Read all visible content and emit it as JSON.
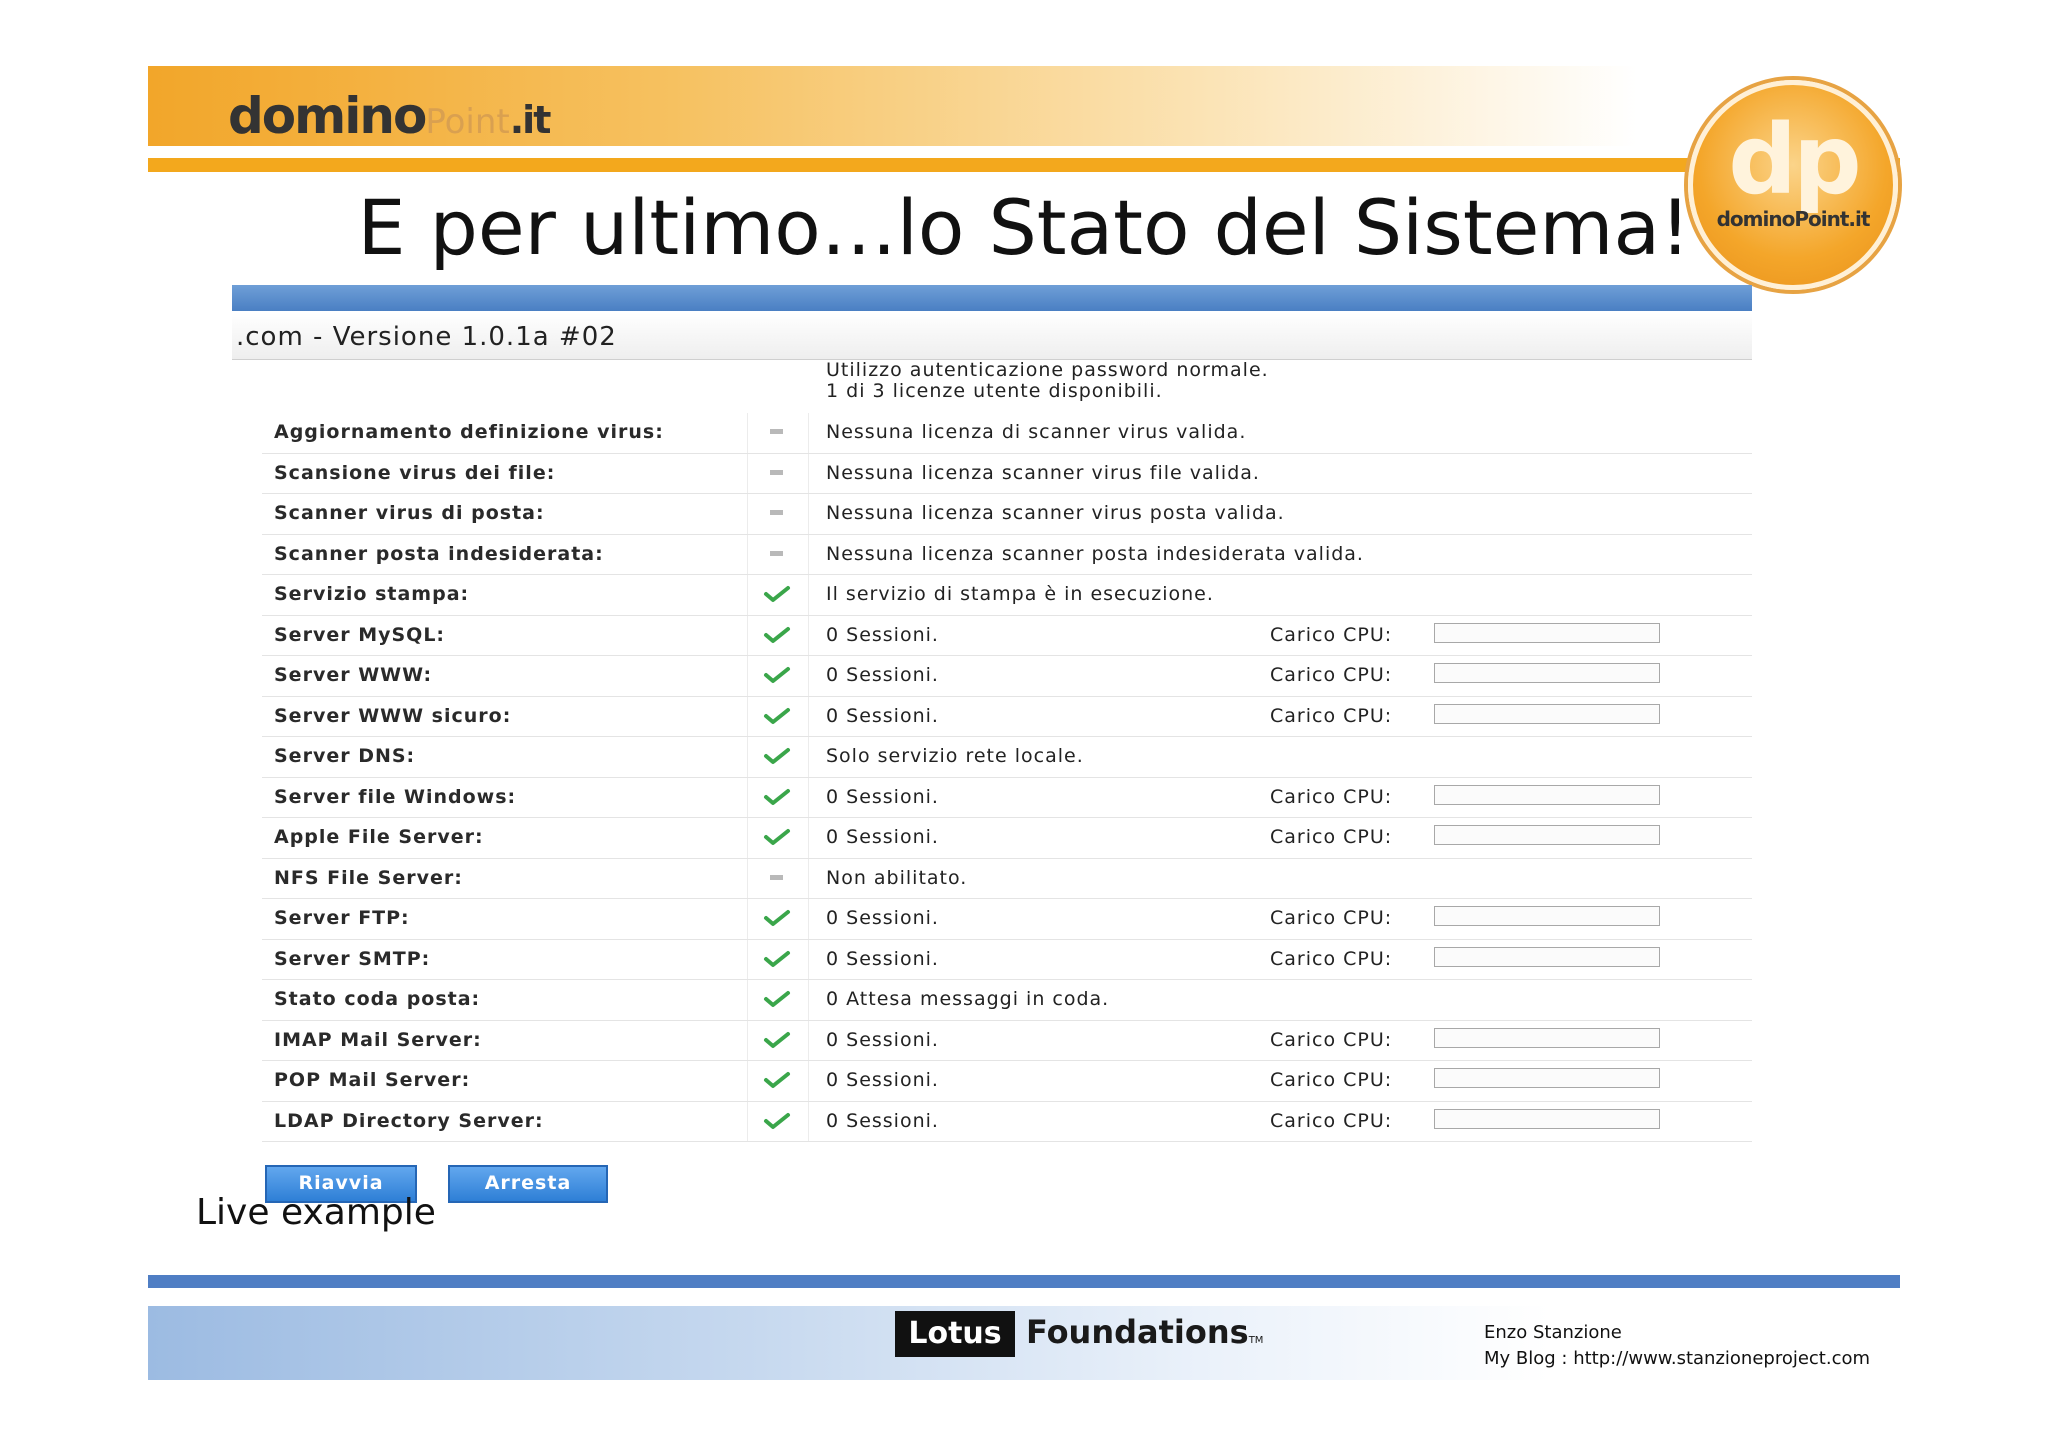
{
  "header": {
    "brand_main": "domino",
    "brand_sub": "Point",
    "brand_suffix": ".it",
    "circle_logo_text": "dp",
    "circle_logo_sub": "dominoPoint.it"
  },
  "slide_title": "E per ultimo…lo Stato del Sistema!",
  "screenshot": {
    "title": ".com - Versione 1.0.1a #02",
    "license_lines": [
      "Utilizzo autenticazione password normale.",
      "1 di 3 licenze utente disponibili."
    ],
    "rows": [
      {
        "name": "Aggiornamento definizione virus:",
        "status": "dash",
        "desc": "Nessuna licenza di scanner virus valida.",
        "cpu": ""
      },
      {
        "name": "Scansione virus dei file:",
        "status": "dash",
        "desc": "Nessuna licenza scanner virus file valida.",
        "cpu": ""
      },
      {
        "name": "Scanner virus di posta:",
        "status": "dash",
        "desc": "Nessuna licenza scanner virus posta valida.",
        "cpu": ""
      },
      {
        "name": "Scanner posta indesiderata:",
        "status": "dash",
        "desc": "Nessuna licenza scanner posta indesiderata valida.",
        "cpu": ""
      },
      {
        "name": "Servizio stampa:",
        "status": "check",
        "desc": "Il servizio di stampa è in esecuzione.",
        "cpu": ""
      },
      {
        "name": "Server MySQL:",
        "status": "check",
        "desc": "0 Sessioni.",
        "cpu": "Carico CPU:"
      },
      {
        "name": "Server WWW:",
        "status": "check",
        "desc": "0 Sessioni.",
        "cpu": "Carico CPU:"
      },
      {
        "name": "Server WWW sicuro:",
        "status": "check",
        "desc": "0 Sessioni.",
        "cpu": "Carico CPU:"
      },
      {
        "name": "Server DNS:",
        "status": "check",
        "desc": "Solo servizio rete locale.",
        "cpu": ""
      },
      {
        "name": "Server file Windows:",
        "status": "check",
        "desc": "0 Sessioni.",
        "cpu": "Carico CPU:"
      },
      {
        "name": "Apple File Server:",
        "status": "check",
        "desc": "0 Sessioni.",
        "cpu": "Carico CPU:"
      },
      {
        "name": "NFS File Server:",
        "status": "dash",
        "desc": "Non abilitato.",
        "cpu": ""
      },
      {
        "name": "Server FTP:",
        "status": "check",
        "desc": "0 Sessioni.",
        "cpu": "Carico CPU:"
      },
      {
        "name": "Server SMTP:",
        "status": "check",
        "desc": "0 Sessioni.",
        "cpu": "Carico CPU:"
      },
      {
        "name": "Stato coda posta:",
        "status": "check",
        "desc": "0 Attesa messaggi in coda.",
        "cpu": ""
      },
      {
        "name": "IMAP Mail Server:",
        "status": "check",
        "desc": "0 Sessioni.",
        "cpu": "Carico CPU:"
      },
      {
        "name": "POP Mail Server:",
        "status": "check",
        "desc": "0 Sessioni.",
        "cpu": "Carico CPU:"
      },
      {
        "name": "LDAP Directory Server:",
        "status": "check",
        "desc": "0 Sessioni.",
        "cpu": "Carico CPU:"
      }
    ],
    "buttons": {
      "restart": "Riavvia",
      "stop": "Arresta"
    },
    "colors": {
      "check": "#3aa64a",
      "dash": "#b9b9b9",
      "button": "#2e7fd6",
      "topbar": "#4a7fc3"
    }
  },
  "live_example": "Live example",
  "footer": {
    "lotus": "Lotus",
    "foundations": "Foundations",
    "tm": "TM",
    "author": "Enzo Stanzione",
    "blog": "My Blog : http://www.stanzioneproject.com"
  }
}
